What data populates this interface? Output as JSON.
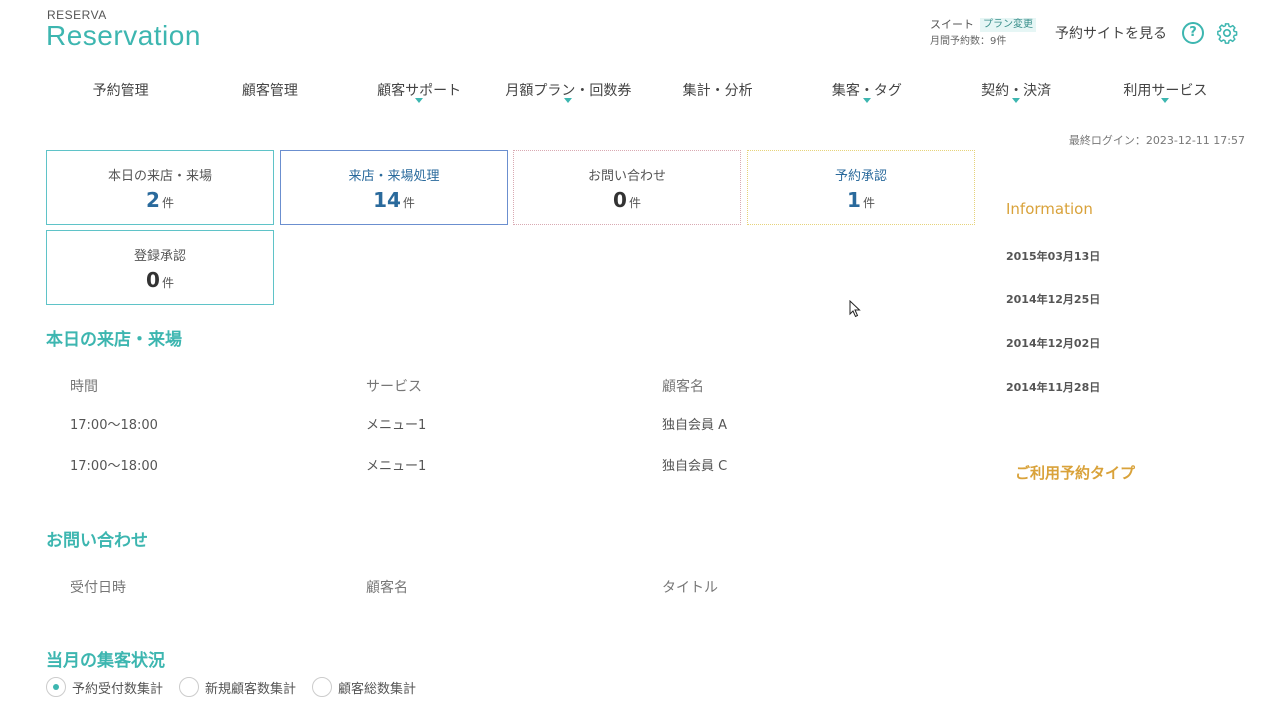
{
  "brand": {
    "small": "RESERVA",
    "big": "Reservation"
  },
  "plan": {
    "name": "スイート",
    "change_badge": "プラン変更",
    "monthly": "月間予約数：9件"
  },
  "header": {
    "view_site": "予約サイトを見る",
    "help_icon": "help-icon",
    "settings_icon": "gear-icon"
  },
  "nav": [
    {
      "label": "予約管理",
      "caret": false
    },
    {
      "label": "顧客管理",
      "caret": false
    },
    {
      "label": "顧客サポート",
      "caret": true
    },
    {
      "label": "月額プラン・回数券",
      "caret": true
    },
    {
      "label": "集計・分析",
      "caret": false
    },
    {
      "label": "集客・タグ",
      "caret": true
    },
    {
      "label": "契約・決済",
      "caret": true
    },
    {
      "label": "利用サービス",
      "caret": true
    }
  ],
  "last_login": "最終ログイン：2023-12-11 17:57",
  "cards": [
    {
      "label": "本日の来店・来場",
      "value": "2",
      "unit": "件"
    },
    {
      "label": "来店・来場処理",
      "value": "14",
      "unit": "件"
    },
    {
      "label": "お問い合わせ",
      "value": "0",
      "unit": "件"
    },
    {
      "label": "予約承認",
      "value": "1",
      "unit": "件"
    },
    {
      "label": "登録承認",
      "value": "0",
      "unit": "件"
    }
  ],
  "today": {
    "title": "本日の来店・来場",
    "headers": [
      "時間",
      "サービス",
      "顧客名"
    ],
    "rows": [
      [
        "17:00〜18:00",
        "メニュー1",
        "独自会員 A"
      ],
      [
        "17:00〜18:00",
        "メニュー1",
        "独自会員 C"
      ]
    ]
  },
  "inquiries": {
    "title": "お問い合わせ",
    "headers": [
      "受付日時",
      "顧客名",
      "タイトル"
    ]
  },
  "monthly": {
    "title": "当月の集客状況",
    "options": [
      "予約受付数集計",
      "新規顧客数集計",
      "顧客総数集計"
    ],
    "selected": 0
  },
  "information": {
    "title": "Information",
    "dates": [
      "2015年03月13日",
      "2014年12月25日",
      "2014年12月02日",
      "2014年11月28日"
    ],
    "reservation_type": "ご利用予約タイプ"
  },
  "colors": {
    "accent": "#3db6b0",
    "orange": "#d9a23a",
    "blue": "#2a6a9c"
  }
}
